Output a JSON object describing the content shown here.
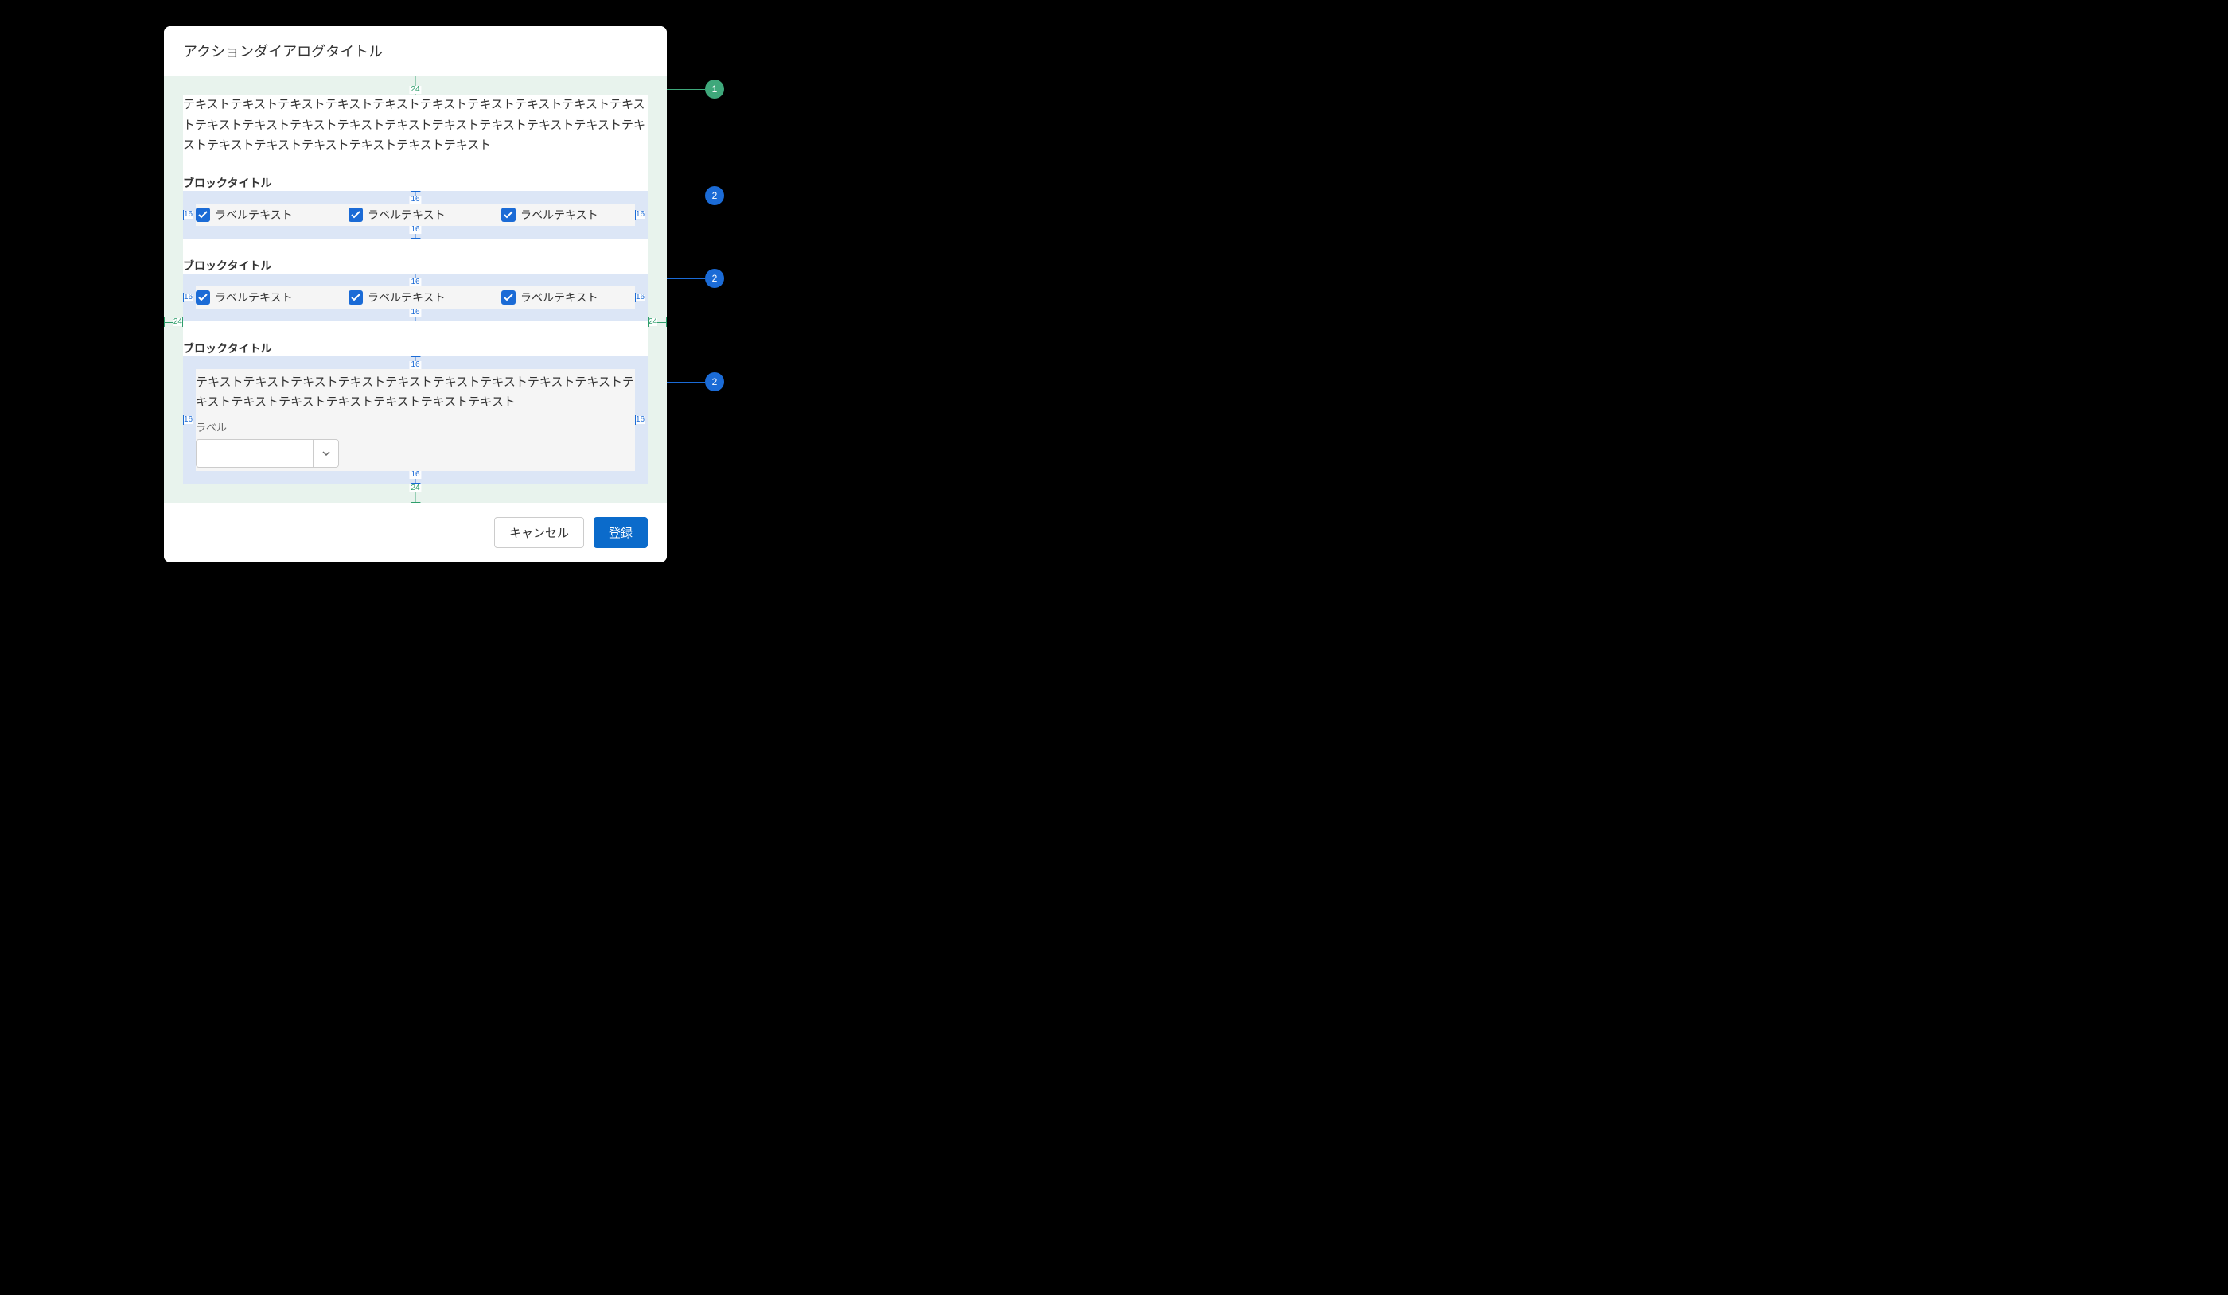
{
  "dialog": {
    "title": "アクションダイアログタイトル",
    "description": "テキストテキストテキストテキストテキストテキストテキストテキストテキストテキストテキストテキストテキストテキストテキストテキストテキストテキストテキストテキストテキストテキストテキストテキストテキストテキスト",
    "blocks": [
      {
        "title": "ブロックタイトル",
        "type": "checkbox",
        "items": [
          {
            "label": "ラベルテキスト",
            "checked": true
          },
          {
            "label": "ラベルテキスト",
            "checked": true
          },
          {
            "label": "ラベルテキスト",
            "checked": true
          }
        ]
      },
      {
        "title": "ブロックタイトル",
        "type": "checkbox",
        "items": [
          {
            "label": "ラベルテキスト",
            "checked": true
          },
          {
            "label": "ラベルテキスト",
            "checked": true
          },
          {
            "label": "ラベルテキスト",
            "checked": true
          }
        ]
      },
      {
        "title": "ブロックタイトル",
        "type": "content",
        "text": "テキストテキストテキストテキストテキストテキストテキストテキストテキストテキストテキストテキストテキストテキストテキストテキスト",
        "select_label": "ラベル",
        "select_value": ""
      }
    ],
    "buttons": {
      "cancel": "キャンセル",
      "submit": "登録"
    }
  },
  "annotations": {
    "spacing_body_v": "24",
    "spacing_body_h": "24",
    "spacing_zone_v": "16",
    "spacing_zone_h": "16",
    "callouts": [
      {
        "n": "1",
        "color": "green"
      },
      {
        "n": "2",
        "color": "blue"
      },
      {
        "n": "2",
        "color": "blue"
      },
      {
        "n": "2",
        "color": "blue"
      }
    ]
  }
}
